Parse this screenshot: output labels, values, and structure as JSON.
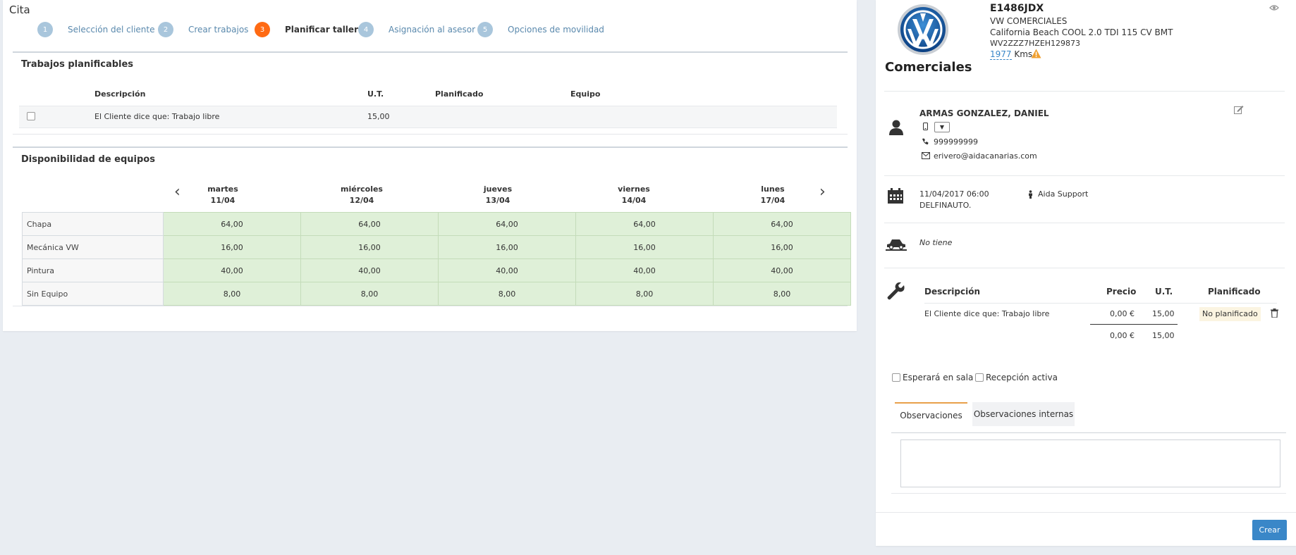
{
  "page_title": "Cita",
  "steps": [
    {
      "num": "1",
      "label": "Selección del cliente"
    },
    {
      "num": "2",
      "label": "Crear trabajos"
    },
    {
      "num": "3",
      "label": "Planificar taller"
    },
    {
      "num": "4",
      "label": "Asignación al asesor"
    },
    {
      "num": "5",
      "label": "Opciones de movilidad"
    }
  ],
  "jobs": {
    "title": "Trabajos planificables",
    "headers": {
      "description": "Descripción",
      "ut": "U.T.",
      "planned": "Planificado",
      "team": "Equipo"
    },
    "rows": [
      {
        "description": "El Cliente dice que: Trabajo libre",
        "ut": "15,00"
      }
    ]
  },
  "availability": {
    "title": "Disponibilidad de equipos",
    "days": [
      {
        "name": "martes",
        "date": "11/04"
      },
      {
        "name": "miércoles",
        "date": "12/04"
      },
      {
        "name": "jueves",
        "date": "13/04"
      },
      {
        "name": "viernes",
        "date": "14/04"
      },
      {
        "name": "lunes",
        "date": "17/04"
      }
    ],
    "rows": [
      {
        "team": "Chapa",
        "values": [
          "64,00",
          "64,00",
          "64,00",
          "64,00",
          "64,00"
        ]
      },
      {
        "team": "Mecánica VW",
        "values": [
          "16,00",
          "16,00",
          "16,00",
          "16,00",
          "16,00"
        ]
      },
      {
        "team": "Pintura",
        "values": [
          "40,00",
          "40,00",
          "40,00",
          "40,00",
          "40,00"
        ]
      },
      {
        "team": "Sin Equipo",
        "values": [
          "8,00",
          "8,00",
          "8,00",
          "8,00",
          "8,00"
        ]
      }
    ]
  },
  "vehicle": {
    "brand_label": "Comerciales",
    "plate": "E1486JDX",
    "make": "VW COMERCIALES",
    "model": "California Beach COOL 2.0 TDI 115 CV BMT",
    "vin": "WV2ZZZ7HZEH129873",
    "km": "1977",
    "km_unit": "Kms"
  },
  "customer": {
    "name": "ARMAS GONZALEZ, DANIEL",
    "phone": "999999999",
    "email": "erivero@aidacanarias.com"
  },
  "appointment": {
    "datetime": "11/04/2017 06:00",
    "workshop": "DELFINAUTO.",
    "advisor": "Aida Support"
  },
  "mobility": {
    "value": "No tiene"
  },
  "works": {
    "headers": {
      "description": "Descripción",
      "price": "Precio",
      "ut": "U.T.",
      "planned": "Planificado"
    },
    "rows": [
      {
        "description": "El Cliente dice que: Trabajo libre",
        "price": "0,00 €",
        "ut": "15,00",
        "planned": "No planificado"
      }
    ],
    "total": {
      "price": "0,00 €",
      "ut": "15,00"
    }
  },
  "options": {
    "wait_label": "Esperará en sala",
    "reception_label": "Recepción activa"
  },
  "tabs": {
    "observations": "Observaciones",
    "internal": "Observaciones internas"
  },
  "create_button": "Crear",
  "colors": {
    "accent": "#ff6a13",
    "primary": "#3a87c8",
    "available": "#dff0d8",
    "step_inactive": "#a9c6dc"
  }
}
